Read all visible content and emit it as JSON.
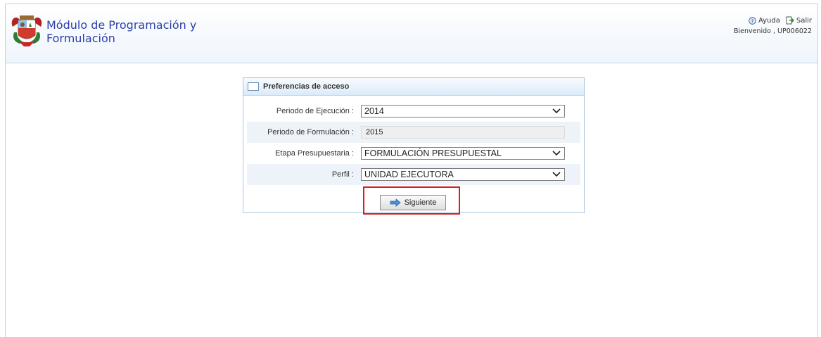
{
  "header": {
    "app_title_line1": "Módulo de Programación y",
    "app_title_line2": "Formulación",
    "help_label": "Ayuda",
    "exit_label": "Salir",
    "welcome_text": "Bienvenido , UP006022"
  },
  "panel": {
    "title": "Preferencias de acceso",
    "fields": [
      {
        "label": "Periodo de Ejecución :",
        "value": "2014"
      },
      {
        "label": "Periodo de Formulación :",
        "value": "2015"
      },
      {
        "label": "Etapa Presupuestaria :",
        "value": "FORMULACIÓN PRESUPUESTAL"
      },
      {
        "label": "Perfil :",
        "value": "UNIDAD EJECUTORA"
      }
    ],
    "next_button": "Siguiente"
  },
  "colors": {
    "title_blue": "#2b3fa8",
    "highlight_red": "#e01c1c",
    "panel_border": "#a9c6e0"
  },
  "icons": [
    "coat-of-arms-logo",
    "help-icon",
    "exit-icon",
    "chevron-down-icon",
    "arrow-right-icon"
  ]
}
